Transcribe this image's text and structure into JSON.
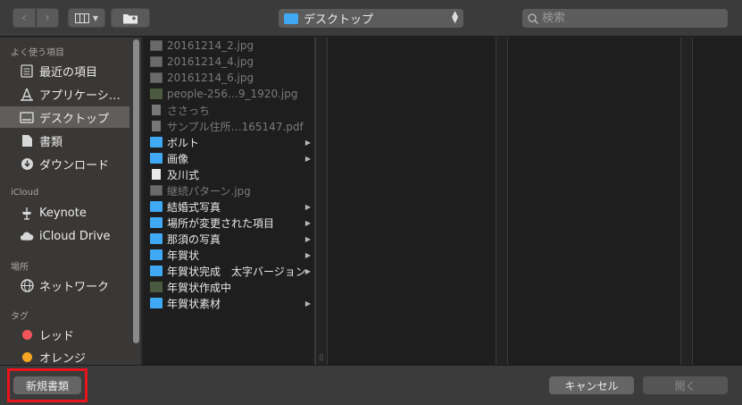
{
  "toolbar": {
    "location": "デスクトップ",
    "search_placeholder": "検索"
  },
  "sidebar": {
    "sections": {
      "favorites": "よく使う項目",
      "icloud": "iCloud",
      "locations": "場所",
      "tags": "タグ"
    },
    "favorites": [
      "最近の項目",
      "アプリケーシ…",
      "デスクトップ",
      "書類",
      "ダウンロード"
    ],
    "icloud": [
      "Keynote",
      "iCloud Drive"
    ],
    "locations": [
      "ネットワーク"
    ],
    "tags": [
      {
        "label": "レッド",
        "color": "#f2545b"
      },
      {
        "label": "オレンジ",
        "color": "#f5a623"
      }
    ]
  },
  "files": [
    "20161214_2.jpg",
    "20161214_4.jpg",
    "20161214_6.jpg",
    "people-256…9_1920.jpg",
    "ささっち",
    "サンプル住所…165147.pdf",
    "ボルト",
    "画像",
    "及川式",
    "継続パターン.jpg",
    "結婚式写真",
    "場所が変更された項目",
    "那須の写真",
    "年賀状",
    "年賀状完成　太字バージョン",
    "年賀状作成中",
    "年賀状素材"
  ],
  "buttons": {
    "new_document": "新規書類",
    "cancel": "キャンセル",
    "open": "開く"
  }
}
